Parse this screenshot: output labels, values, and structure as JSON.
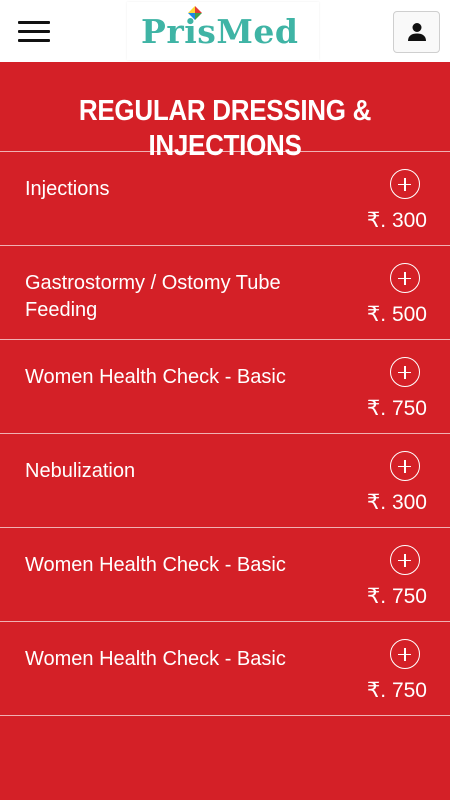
{
  "app": {
    "logo_text": "PrisMed",
    "brand_color": "#3fb4a5",
    "accent_color": "#d42027"
  },
  "header": {
    "menu_icon": "hamburger-menu-icon",
    "profile_icon": "user-icon"
  },
  "page": {
    "title": "REGULAR DRESSING & INJECTIONS"
  },
  "services": [
    {
      "name": "Injections",
      "price": "₹. 300"
    },
    {
      "name": "Gastrostormy / Ostomy Tube Feeding",
      "price": "₹. 500"
    },
    {
      "name": "Women Health Check - Basic",
      "price": "₹. 750"
    },
    {
      "name": "Nebulization",
      "price": "₹. 300"
    },
    {
      "name": "Women Health Check - Basic",
      "price": "₹. 750"
    },
    {
      "name": "Women Health Check - Basic",
      "price": "₹. 750"
    }
  ]
}
